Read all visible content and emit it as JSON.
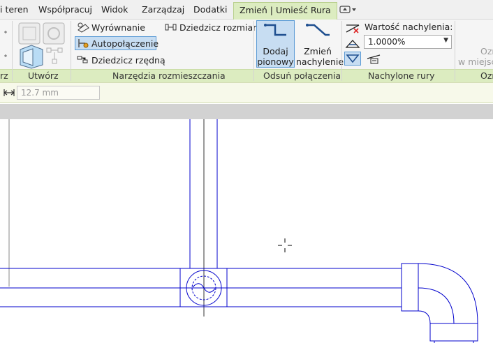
{
  "menu_tabs": [
    {
      "label": "i teren"
    },
    {
      "label": "Współpracuj"
    },
    {
      "label": "Widok"
    },
    {
      "label": "Zarządzaj"
    },
    {
      "label": "Dodatki"
    },
    {
      "label": "Zmień | Umieść Rura",
      "active": true
    }
  ],
  "ribbon": {
    "panels": {
      "left_partial": "rz",
      "utworz": "Utwórz",
      "placement_tools": "Narzędzia rozmieszczania",
      "offset_connections": "Odsuń połączenia",
      "sloped_pipes": "Nachylone rury",
      "right_partial": "Ozn"
    },
    "placement_tools": {
      "justify": "Wyrównanie",
      "autoconnect": "Autopołączenie",
      "inherit_elevation": "Dziedzicz rzędną",
      "inherit_size": "Dziedzicz rozmiar"
    },
    "offset_connections": {
      "add_vertical": [
        "Dodaj",
        "pionowy"
      ],
      "change_slope": [
        "Zmień",
        "nachylenie"
      ]
    },
    "sloped_pipes": {
      "slope_value_label": "Wartość nachylenia:",
      "slope_value": "1.0000%"
    },
    "tag_panel": {
      "line1": "Ozn",
      "line2": "w miejscu"
    }
  },
  "options_bar": {
    "offset_value": "12.7 mm"
  },
  "colors": {
    "contextual_tab": "#dcecc0",
    "active_button": "#c7ddf2",
    "pipe_lines": "#0000cc"
  },
  "icons": [
    "dropdown-arrow-icon",
    "cursor-crosshair-icon"
  ]
}
